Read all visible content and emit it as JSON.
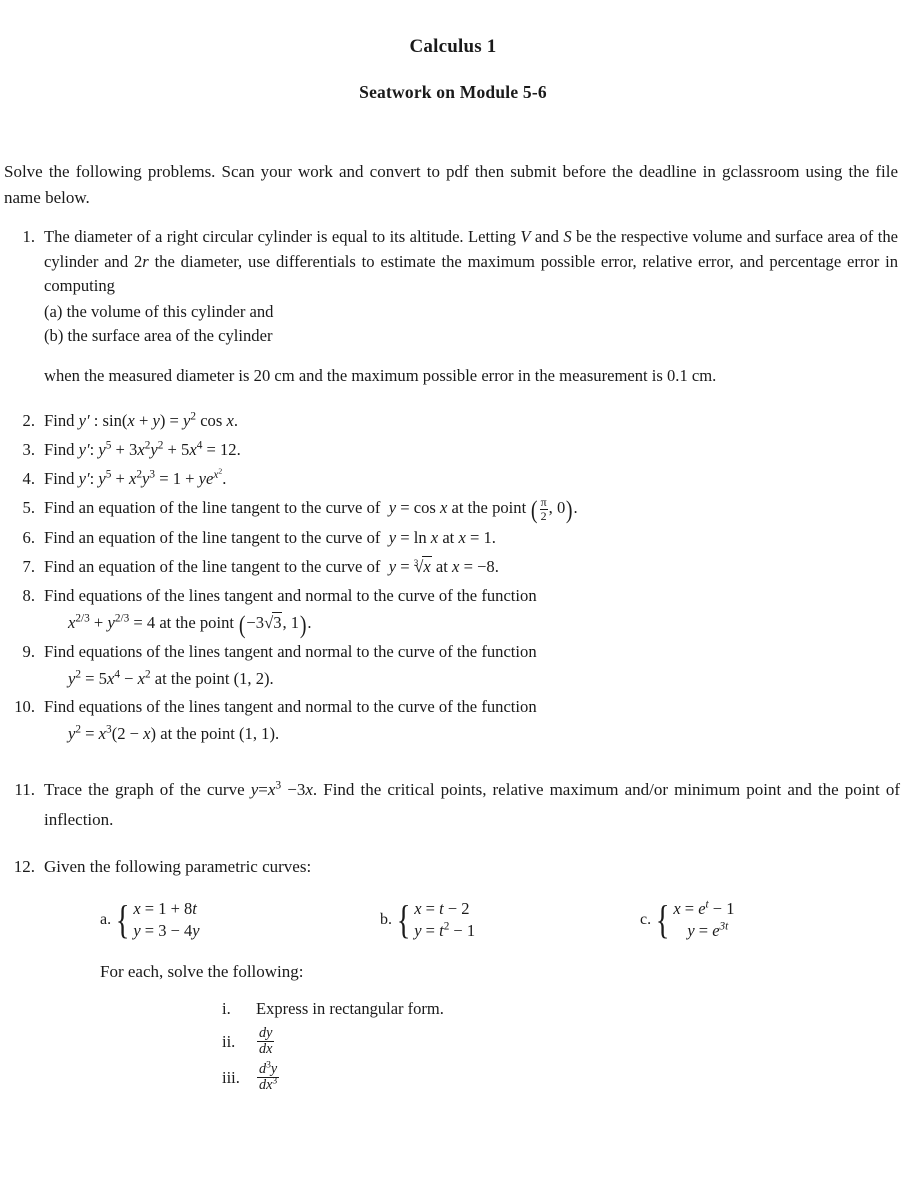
{
  "document": {
    "title": "Calculus 1",
    "subtitle": "Seatwork on Module 5-6",
    "instructions": "Solve the following problems. Scan your work and convert to pdf then submit before the deadline in gclassroom using the file name below."
  },
  "problems": {
    "item1": {
      "marker": "1.",
      "text": "The diameter of a right circular cylinder is equal to its altitude. Letting V and S be the respective volume and surface area of the cylinder and 2r the diameter, use differentials to estimate the maximum possible error, relative error, and percentage error in computing",
      "sub_a": "(a) the volume of this cylinder and",
      "sub_b": "(b) the surface area of the cylinder",
      "tail": "when the measured diameter is 20 cm and the maximum possible error in the measurement is 0.1 cm."
    },
    "item2": {
      "marker": "2.",
      "text": "Find y′ : sin(x + y) = y² cos x."
    },
    "item3": {
      "marker": "3.",
      "text": "Find y′: y⁵ + 3x²y² + 5x⁴ = 12."
    },
    "item4": {
      "marker": "4.",
      "text": "Find y′: y⁵ + x²y³ = 1 + ye^(x²)."
    },
    "item5": {
      "marker": "5.",
      "text": "Find an equation of the line tangent to the curve of y = cos x at the point (π/2, 0)."
    },
    "item6": {
      "marker": "6.",
      "text": "Find an equation of the line tangent to the curve of y = ln x at x = 1."
    },
    "item7": {
      "marker": "7.",
      "text": "Find an equation of the line tangent to the curve of y = ∛x at x = −8."
    },
    "item8": {
      "marker": "8.",
      "text": "Find equations of the lines tangent and normal to the curve of the function",
      "equation": "x^(2/3) + y^(2/3) = 4 at the point (−3√3, 1)."
    },
    "item9": {
      "marker": "9.",
      "text": "Find equations of the lines tangent and normal to the curve of the function",
      "equation": "y² = 5x⁴ − x² at the point (1, 2)."
    },
    "item10": {
      "marker": "10.",
      "text": "Find equations of the lines tangent and normal to the curve of the function",
      "equation": "y² = x³(2 − x) at the point (1, 1)."
    },
    "item11": {
      "marker": "11.",
      "text": "Trace the graph of the curve y = x³ − 3x. Find the critical points, relative maximum and/or minimum point and the point of inflection."
    },
    "item12": {
      "marker": "12.",
      "text": "Given the following parametric curves:",
      "curves": [
        {
          "label": "a.",
          "x_eq": "x = 1 + 8t",
          "y_eq": "y = 3 − 4y"
        },
        {
          "label": "b.",
          "x_eq": "x = t − 2",
          "y_eq": "y = t² − 1"
        },
        {
          "label": "c.",
          "x_eq": "x = e^t − 1",
          "y_eq": "y = e^(3t)"
        }
      ],
      "foreach": "For each, solve the following:",
      "subitems": [
        {
          "marker": "i.",
          "text": "Express in rectangular form."
        },
        {
          "marker": "ii.",
          "text": "dy/dx"
        },
        {
          "marker": "iii.",
          "text": "d³y/dx³"
        }
      ]
    }
  }
}
